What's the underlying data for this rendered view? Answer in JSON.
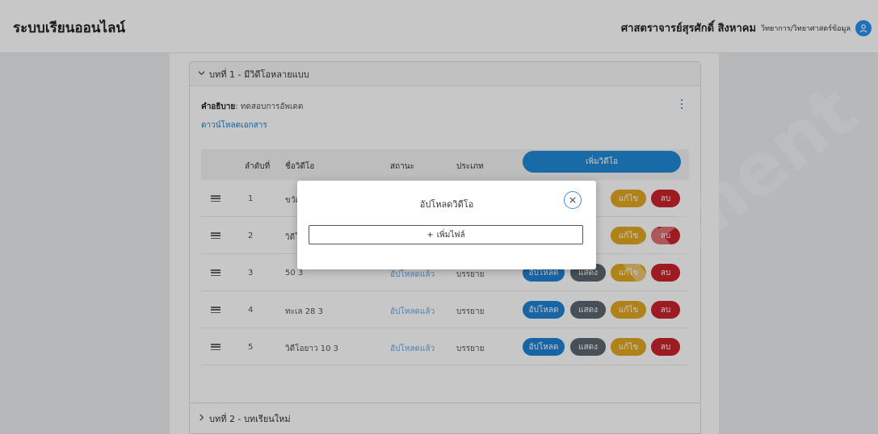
{
  "app": {
    "title": "ระบบเรียนออนไลน์"
  },
  "user": {
    "name": "ศาสตราจารย์สุรศักดิ์ สิงหาคม",
    "role": "วิทยาการ/วิทยาศาสตร์ข้อมูล"
  },
  "lesson1": {
    "title": "บทที่ 1 - มีวิดีโอหลายแบบ",
    "desc_label": "คำอธิบาย",
    "desc_value": ": ทดสอบการอัพเดต",
    "download_link": "ดาวน์โหลดเอกสาร",
    "table": {
      "headers": [
        "ลำดับที่",
        "ชื่อวิดีโอ",
        "สถานะ",
        "ประเภท"
      ],
      "add_button": "เพิ่มวิดีโอ",
      "rows": [
        {
          "no": "1",
          "name": "ขวัญใจ",
          "status": "",
          "type": ""
        },
        {
          "no": "2",
          "name": "วิดีโอยา",
          "status": "",
          "type": ""
        },
        {
          "no": "3",
          "name": "50 3",
          "status": "อัปโหลดแล้ว",
          "type": "บรรยาย"
        },
        {
          "no": "4",
          "name": "ทะเล 28 3",
          "status": "อัปโหลดแล้ว",
          "type": "บรรยาย"
        },
        {
          "no": "5",
          "name": "วิดีโอยาว 10 3",
          "status": "อัปโหลดแล้ว",
          "type": "บรรยาย"
        }
      ],
      "btn_upload": "อัปโหลด",
      "btn_show": "แสดง",
      "btn_edit": "แก้ไข",
      "btn_delete": "ลบ"
    }
  },
  "lesson2": {
    "title": "บทที่ 2 - บทเรียนใหม่"
  },
  "modal": {
    "title": "อัปโหลดวิดีโอ",
    "add_file": "เพิ่มไฟล์"
  },
  "watermark": "rtment",
  "colors": {
    "primary": "#2089d6",
    "show": "#5c6670",
    "edit": "#e0a820",
    "delete": "#c9242c"
  }
}
